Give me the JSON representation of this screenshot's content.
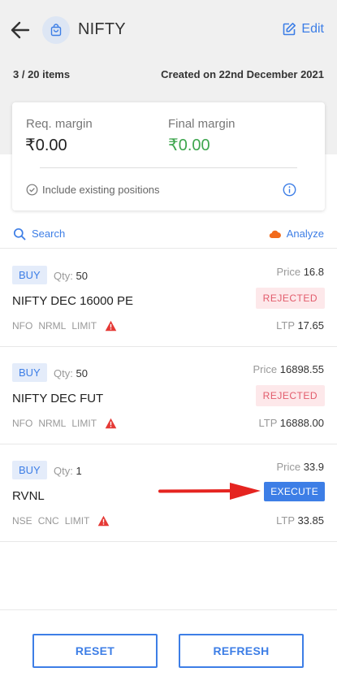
{
  "header": {
    "title": "NIFTY",
    "edit_label": "Edit"
  },
  "meta": {
    "items_count": "3 / 20 items",
    "created": "Created on 22nd December 2021"
  },
  "margin": {
    "req_label": "Req. margin",
    "req_value": "₹0.00",
    "final_label": "Final margin",
    "final_value": "₹0.00",
    "include_label": "Include existing positions"
  },
  "toolbar": {
    "search_label": "Search",
    "analyze_label": "Analyze"
  },
  "orders": [
    {
      "side": "BUY",
      "qty_label": "Qty:",
      "qty": "50",
      "price_label": "Price",
      "price": "16.8",
      "name": "NIFTY DEC 16000 PE",
      "status": "REJECTED",
      "tags": [
        "NFO",
        "NRML",
        "LIMIT"
      ],
      "ltp_label": "LTP",
      "ltp": "17.65"
    },
    {
      "side": "BUY",
      "qty_label": "Qty:",
      "qty": "50",
      "price_label": "Price",
      "price": "16898.55",
      "name": "NIFTY DEC FUT",
      "status": "REJECTED",
      "tags": [
        "NFO",
        "NRML",
        "LIMIT"
      ],
      "ltp_label": "LTP",
      "ltp": "16888.00"
    },
    {
      "side": "BUY",
      "qty_label": "Qty:",
      "qty": "1",
      "price_label": "Price",
      "price": "33.9",
      "name": "RVNL",
      "status": "EXECUTE",
      "tags": [
        "NSE",
        "CNC",
        "LIMIT"
      ],
      "ltp_label": "LTP",
      "ltp": "33.85"
    }
  ],
  "footer": {
    "reset_label": "RESET",
    "refresh_label": "REFRESH"
  },
  "colors": {
    "accent": "#3d7ee6",
    "rejected": "#e25b6b",
    "positive": "#3ea64e",
    "warning": "#e53935",
    "annotation_arrow": "#e52420"
  },
  "icons": {
    "back": "arrow-left-icon",
    "basket": "basket-icon",
    "edit": "edit-icon",
    "check": "check-circle-icon",
    "info": "info-icon",
    "search": "search-icon",
    "analyze": "cloud-icon",
    "warning": "warning-icon"
  }
}
